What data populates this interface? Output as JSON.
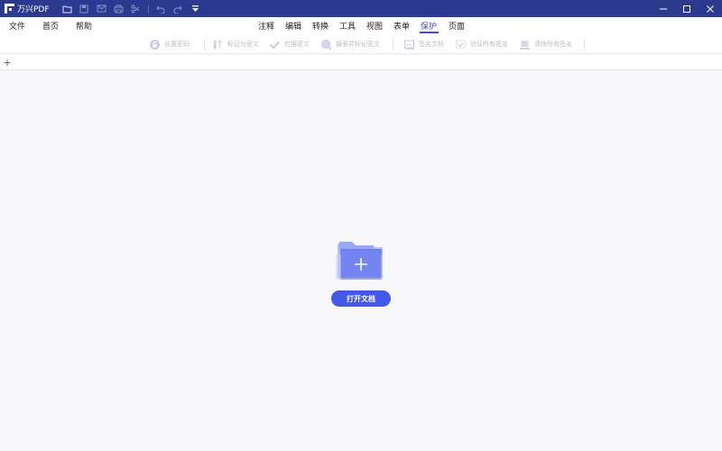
{
  "app": {
    "name": "万兴PDF"
  },
  "quick_access": {
    "icons": [
      "folder-icon",
      "save-icon",
      "mail-icon",
      "print-icon",
      "scissors-icon",
      "undo-icon",
      "redo-icon",
      "dropdown-icon"
    ]
  },
  "window_controls": [
    "minimize-icon",
    "maximize-icon",
    "close-icon"
  ],
  "menu": {
    "file": "文件",
    "home": "首页",
    "help": "帮助"
  },
  "tabs": [
    {
      "label": "注释"
    },
    {
      "label": "编辑"
    },
    {
      "label": "转换"
    },
    {
      "label": "工具"
    },
    {
      "label": "视图"
    },
    {
      "label": "表单"
    },
    {
      "label": "保护",
      "active": true
    },
    {
      "label": "页面"
    }
  ],
  "toolbar": {
    "items": [
      {
        "label": "设置密码",
        "icon": "lock-icon"
      },
      {
        "label": "标记为密文",
        "icon": "redact-mark-icon"
      },
      {
        "label": "应用密文",
        "icon": "apply-redaction-icon"
      },
      {
        "label": "搜索并标记密文",
        "icon": "search-redact-icon"
      },
      {
        "label": "签名文档",
        "icon": "sign-document-icon"
      },
      {
        "label": "验证所有签名",
        "icon": "verify-signature-icon"
      },
      {
        "label": "清除所有签名",
        "icon": "clear-signature-icon"
      }
    ]
  },
  "tabstrip": {
    "new_tab": "+"
  },
  "main": {
    "open_button": "打开文档"
  },
  "colors": {
    "titlebar": "#2b3a8e",
    "accent": "#4557e6",
    "disabled_text": "#b8bccb"
  }
}
